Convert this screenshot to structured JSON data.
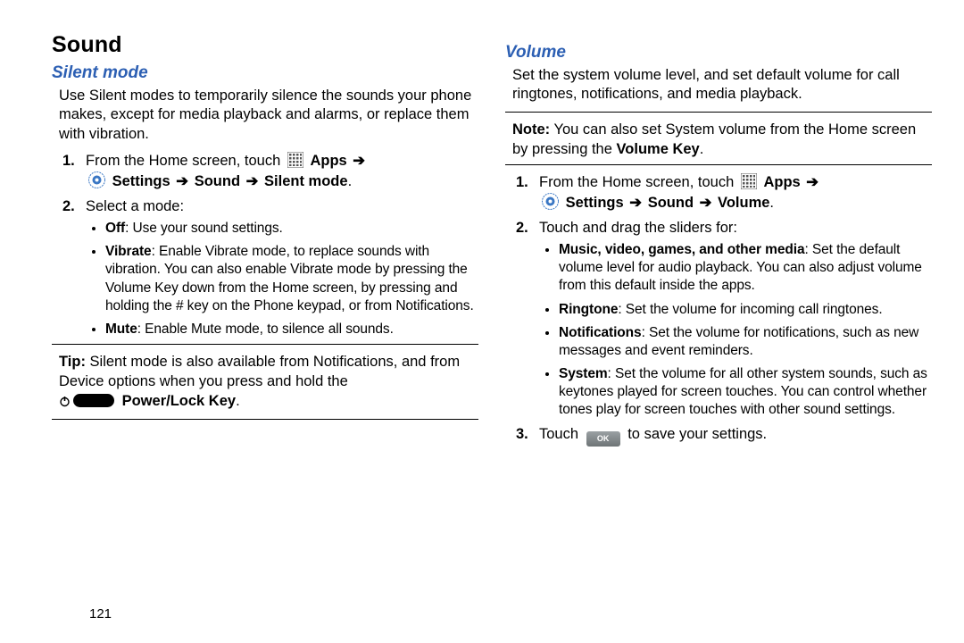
{
  "page_number": "121",
  "left": {
    "h1": "Sound",
    "h2": "Silent mode",
    "intro": "Use Silent modes to temporarily silence the sounds your phone makes, except for media playback and alarms, or replace them with vibration.",
    "step1_before": "From the Home screen, touch",
    "apps_label": "Apps",
    "settings_label": "Settings",
    "sound_label": "Sound",
    "silent_label": "Silent mode",
    "step2": "Select a mode:",
    "bullets": {
      "off_label": "Off",
      "off_text": ": Use your sound settings.",
      "vib_label": "Vibrate",
      "vib_text": ": Enable Vibrate mode, to replace sounds with vibration. You can also enable Vibrate mode by pressing the Volume Key down from the Home screen, by pressing and holding the # key on the Phone keypad, or from Notifications.",
      "mute_label": "Mute",
      "mute_text": ": Enable Mute mode, to silence all sounds."
    },
    "tip_label": "Tip:",
    "tip_text_1": "Silent mode is also available from Notifications, and from Device options when you press and hold the",
    "power_lock": "Power/Lock Key"
  },
  "right": {
    "h2": "Volume",
    "intro": "Set the system volume level, and set default volume for call ringtones, notifications, and media playback.",
    "note_label": "Note:",
    "note_text_1": "You can also set System volume from the Home screen by pressing the",
    "volume_key": "Volume Key",
    "step1_before": "From the Home screen, touch",
    "apps_label": "Apps",
    "settings_label": "Settings",
    "sound_label": "Sound",
    "volume_label": "Volume",
    "step2": "Touch and drag the sliders for:",
    "bullets": {
      "m_label": "Music, video, games, and other media",
      "m_text": ": Set the default volume level for audio playback. You can also adjust volume from this default inside the apps.",
      "r_label": "Ringtone",
      "r_text": ": Set the volume for incoming call ringtones.",
      "n_label": "Notifications",
      "n_text": ": Set the volume for notifications, such as new messages and event reminders.",
      "s_label": "System",
      "s_text": ": Set the volume for all other system sounds, such as keytones played for screen touches. You can control whether tones play for screen touches with other sound settings."
    },
    "step3_a": "Touch",
    "step3_ok": "OK",
    "step3_b": "to save your settings."
  }
}
